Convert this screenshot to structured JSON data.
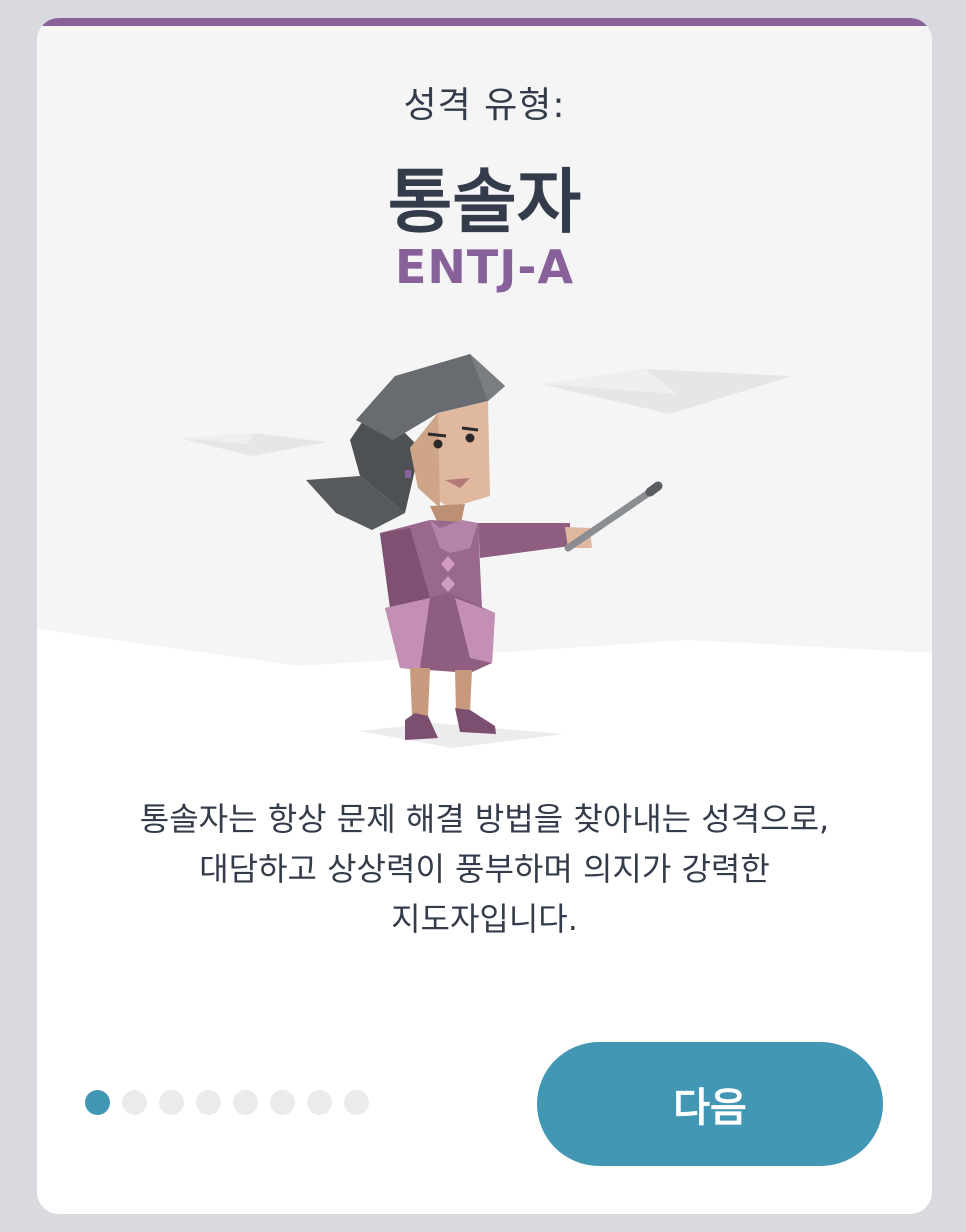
{
  "card": {
    "eyebrow": "성격 유형:",
    "type_name": "통솔자",
    "type_code": "ENTJ-A",
    "description_lines": [
      "통솔자는 항상 문제 해결 방법을 찾아내는 성격으로,",
      "대담하고 상상력이 풍부하며 의지가 강력한",
      "지도자입니다."
    ],
    "illustration": "commander-woman-with-pointer-icon"
  },
  "pagination": {
    "total": 8,
    "current": 1
  },
  "actions": {
    "next_label": "다음"
  },
  "colors": {
    "accent_purple": "#88619a",
    "button_teal": "#4298b4",
    "text_dark": "#343c4b",
    "backdrop": "#d9dadf"
  }
}
